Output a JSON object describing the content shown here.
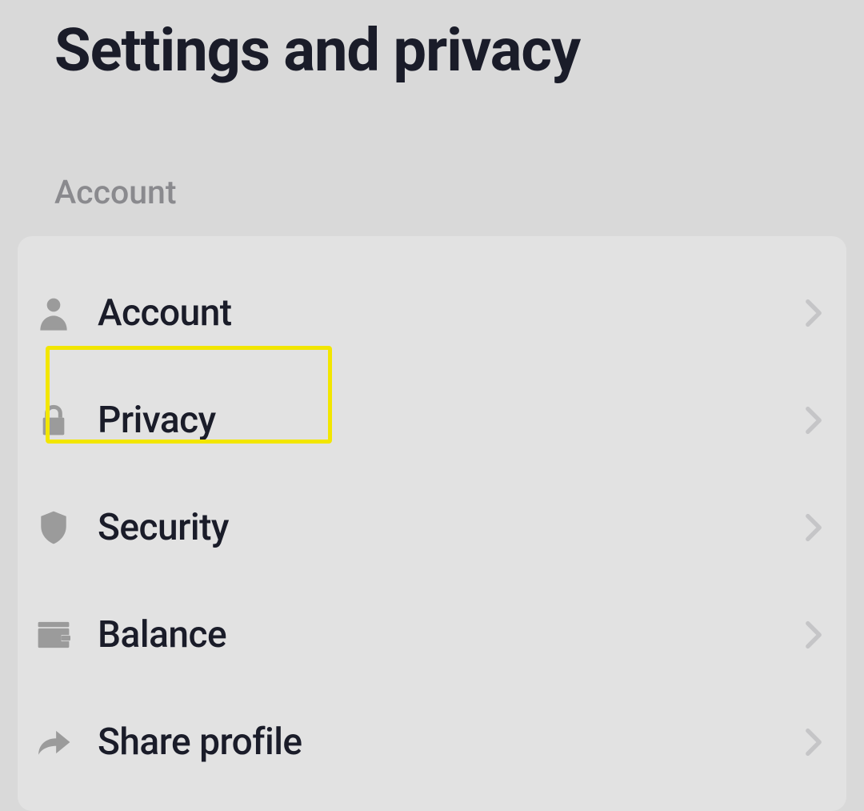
{
  "page": {
    "title": "Settings and privacy"
  },
  "section": {
    "label": "Account",
    "items": [
      {
        "label": "Account",
        "icon": "person-icon"
      },
      {
        "label": "Privacy",
        "icon": "lock-icon"
      },
      {
        "label": "Security",
        "icon": "shield-icon"
      },
      {
        "label": "Balance",
        "icon": "wallet-icon"
      },
      {
        "label": "Share profile",
        "icon": "share-icon"
      }
    ]
  },
  "highlight": {
    "target_item_index": 1
  }
}
